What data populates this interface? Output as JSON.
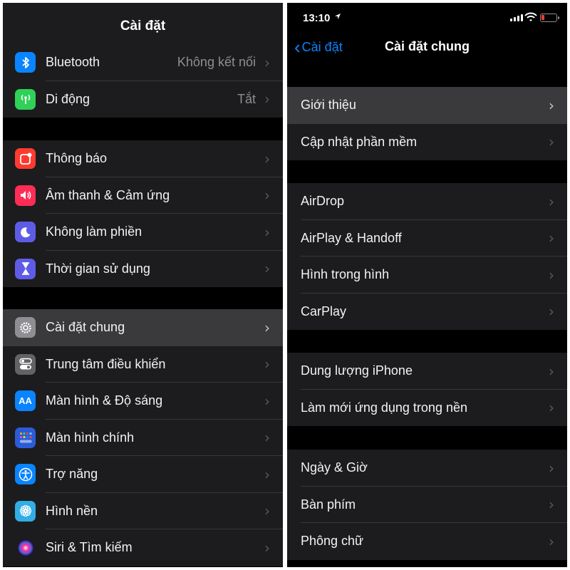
{
  "left": {
    "title": "Cài đặt",
    "groups": [
      [
        {
          "label": "Bluetooth",
          "value": "Không kết nối",
          "icon": "bluetooth-icon",
          "color": "#0a84ff"
        },
        {
          "label": "Di động",
          "value": "Tắt",
          "icon": "antenna-icon",
          "color": "#30d158"
        }
      ],
      [
        {
          "label": "Thông báo",
          "icon": "notification-icon",
          "color": "#ff3b30"
        },
        {
          "label": "Âm thanh & Cảm ứng",
          "icon": "speaker-icon",
          "color": "#ff2d55"
        },
        {
          "label": "Không làm phiền",
          "icon": "moon-icon",
          "color": "#5e5ce6"
        },
        {
          "label": "Thời gian sử dụng",
          "icon": "hourglass-icon",
          "color": "#5e5ce6"
        }
      ],
      [
        {
          "label": "Cài đặt chung",
          "icon": "gear-icon",
          "color": "#8e8e93"
        },
        {
          "label": "Trung tâm điều khiển",
          "icon": "toggle-icon",
          "color": "#636366"
        },
        {
          "label": "Màn hình & Độ sáng",
          "icon": "text-size-icon",
          "icon_text": "AA",
          "color": "#0a84ff"
        },
        {
          "label": "Màn hình chính",
          "icon": "home-grid-icon",
          "color": "#2c5bd8"
        },
        {
          "label": "Trợ năng",
          "icon": "accessibility-icon",
          "color": "#0a84ff"
        },
        {
          "label": "Hình nền",
          "icon": "flower-icon",
          "color": "#32ade6"
        },
        {
          "label": "Siri & Tìm kiếm",
          "icon": "siri-icon",
          "color": "#1c1c1e"
        }
      ]
    ]
  },
  "right": {
    "status": {
      "time": "13:10"
    },
    "nav": {
      "back_label": "Cài đặt",
      "title": "Cài đặt chung"
    },
    "groups": [
      [
        {
          "label": "Giới thiệu"
        },
        {
          "label": "Cập nhật phần mềm"
        }
      ],
      [
        {
          "label": "AirDrop"
        },
        {
          "label": "AirPlay & Handoff"
        },
        {
          "label": "Hình trong hình"
        },
        {
          "label": "CarPlay"
        }
      ],
      [
        {
          "label": "Dung lượng iPhone"
        },
        {
          "label": "Làm mới ứng dụng trong nền"
        }
      ],
      [
        {
          "label": "Ngày & Giờ"
        },
        {
          "label": "Bàn phím"
        },
        {
          "label": "Phông chữ"
        }
      ]
    ]
  }
}
